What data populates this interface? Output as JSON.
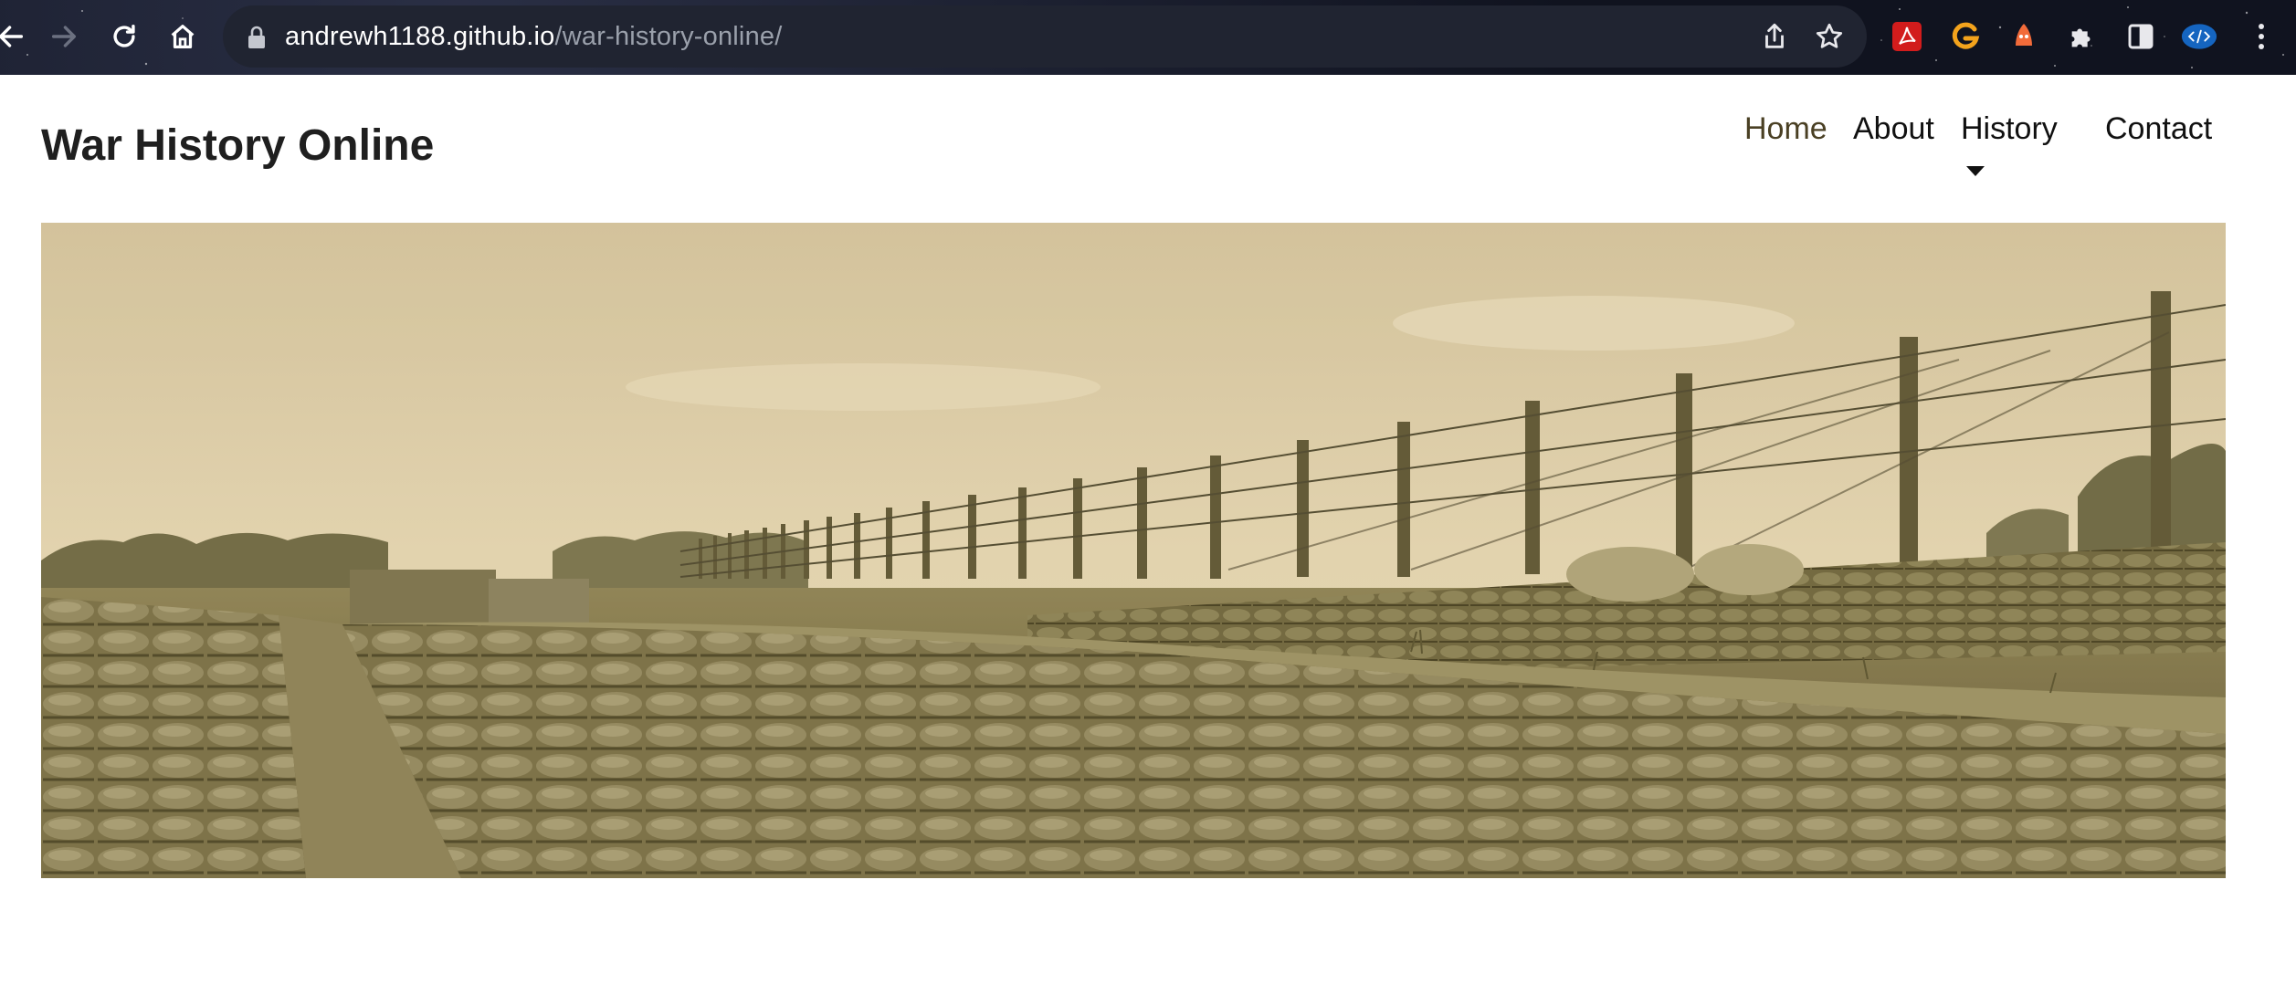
{
  "browser": {
    "url_host": "andrewh1188.github.io",
    "url_path": "/war-history-online/",
    "icons": [
      "back-arrow-icon",
      "forward-arrow-icon",
      "reload-icon",
      "home-icon",
      "lock-icon",
      "share-icon",
      "star-icon",
      "pdf-extension-icon",
      "grammarly-extension-icon",
      "ghost-extension-icon",
      "puzzle-extensions-icon",
      "reading-list-icon",
      "code-extension-icon",
      "more-menu-icon"
    ]
  },
  "site": {
    "title": "War History Online"
  },
  "nav": {
    "items": [
      {
        "label": "Home",
        "active": true
      },
      {
        "label": "About",
        "active": false
      },
      {
        "label": "History",
        "active": false,
        "has_dropdown": true
      },
      {
        "label": "Contact",
        "active": false
      }
    ]
  },
  "hero": {
    "image": "sepia-trench-sandbags-barbed-wire-photo",
    "tone": "#c9b78f"
  }
}
